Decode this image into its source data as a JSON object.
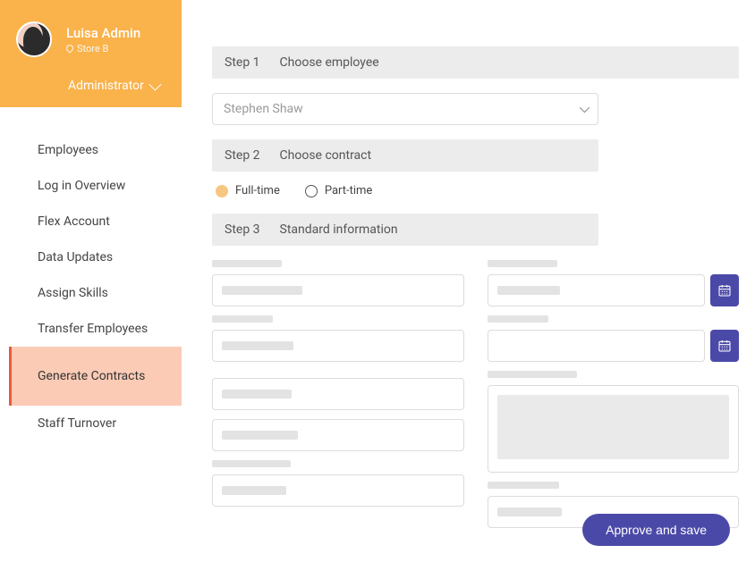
{
  "profile": {
    "name": "Luisa Admin",
    "location": "Store B",
    "role": "Administrator"
  },
  "nav": {
    "items": [
      {
        "label": "Employees"
      },
      {
        "label": "Log in Overview"
      },
      {
        "label": "Flex Account"
      },
      {
        "label": "Data Updates"
      },
      {
        "label": "Assign Skills"
      },
      {
        "label": "Transfer Employees"
      },
      {
        "label": "Generate Contracts"
      },
      {
        "label": "Staff Turnover"
      }
    ],
    "active_index": 6
  },
  "steps": {
    "s1": {
      "step": "Step 1",
      "title": "Choose employee"
    },
    "s2": {
      "step": "Step 2",
      "title": "Choose contract"
    },
    "s3": {
      "step": "Step 3",
      "title": "Standard information"
    }
  },
  "employee_select": {
    "value": "Stephen Shaw"
  },
  "contract": {
    "full_time": "Full-time",
    "part_time": "Part-time",
    "selected": "full_time"
  },
  "buttons": {
    "approve": "Approve and save"
  },
  "icons": {
    "calendar": "calendar-icon"
  }
}
